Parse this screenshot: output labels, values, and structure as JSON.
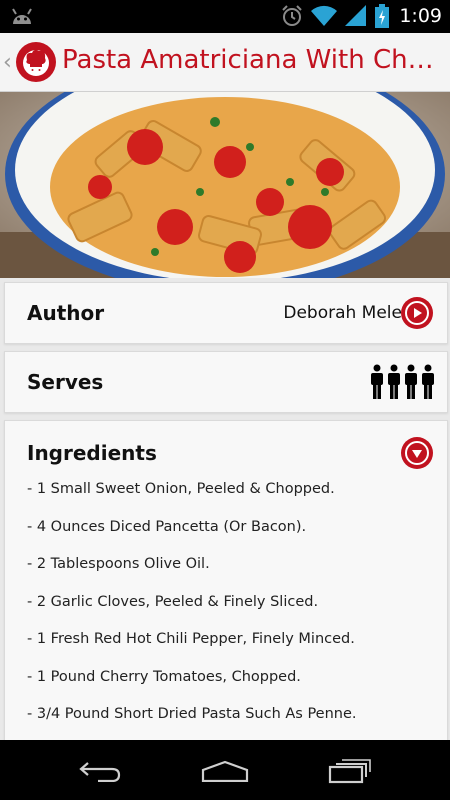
{
  "status_bar": {
    "time": "1:09"
  },
  "action_bar": {
    "title": "Pasta Amatriciana With Cherry Tomatoes"
  },
  "author": {
    "label": "Author",
    "name": "Deborah Mele"
  },
  "serves": {
    "label": "Serves",
    "people_count": 4
  },
  "ingredients": {
    "label": "Ingredients",
    "items": [
      "- 1 Small Sweet Onion, Peeled & Chopped.",
      "- 4 Ounces Diced Pancetta (Or Bacon).",
      "- 2 Tablespoons Olive Oil.",
      "- 2 Garlic Cloves, Peeled & Finely Sliced.",
      "- 1 Fresh Red Hot Chili Pepper, Finely Minced.",
      "- 1 Pound Cherry Tomatoes, Chopped.",
      "- 3/4 Pound Short Dried Pasta Such As Penne."
    ]
  },
  "colors": {
    "accent": "#c1121f",
    "card_bg": "#f8f8f8",
    "page_bg": "#e9e9e9"
  }
}
